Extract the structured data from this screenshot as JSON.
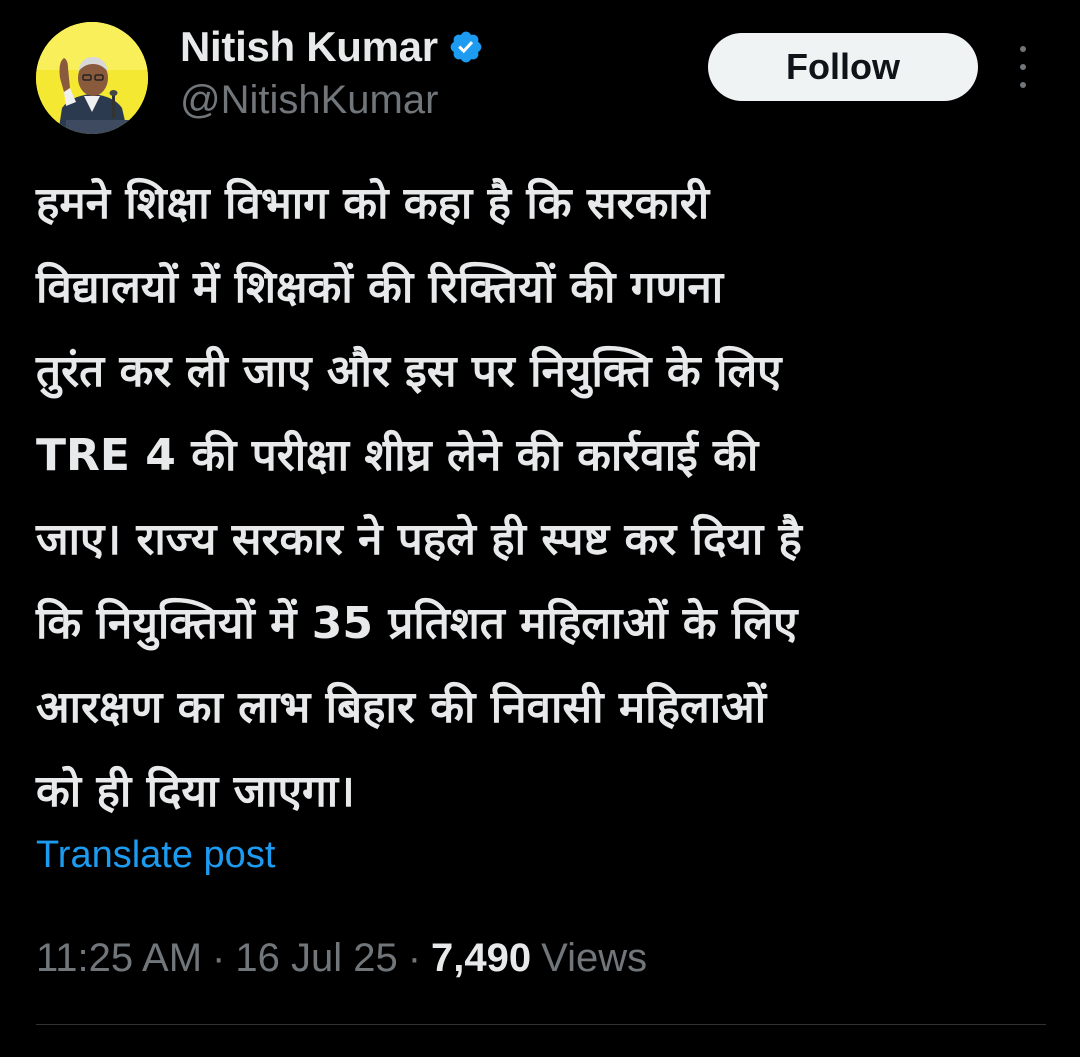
{
  "author": {
    "display_name": "Nitish Kumar",
    "handle": "@NitishKumar",
    "verified": true,
    "avatar_icon": "profile-photo-speaking-at-podium"
  },
  "actions": {
    "follow_label": "Follow",
    "more_icon": "vertical-ellipsis-icon"
  },
  "post": {
    "lines": [
      "हमने शिक्षा विभाग को कहा है कि सरकारी",
      "विद्यालयों में शिक्षकों की रिक्तियों की गणना",
      "तुरंत कर ली जाए और इस पर नियुक्ति के लिए",
      "TRE 4 की परीक्षा शीघ्र लेने की कार्रवाई की",
      "जाए। राज्य सरकार ने पहले ही स्पष्ट कर दिया है",
      "कि नियुक्तियों में 35 प्रतिशत महिलाओं के लिए",
      "आरक्षण का लाभ बिहार की निवासी महिलाओं",
      "को ही दिया जाएगा।"
    ],
    "translate_label": "Translate post"
  },
  "meta": {
    "time": "11:25 AM",
    "separator": "·",
    "date": "16 Jul 25",
    "views_count": "7,490",
    "views_label": "Views"
  },
  "colors": {
    "background": "#000000",
    "text_primary": "#e7e9ea",
    "text_secondary": "#71767b",
    "link": "#1d9bf0",
    "verified_badge": "#1d9bf0",
    "follow_button_bg": "#eff3f4",
    "avatar_bg": "#f5e832"
  }
}
